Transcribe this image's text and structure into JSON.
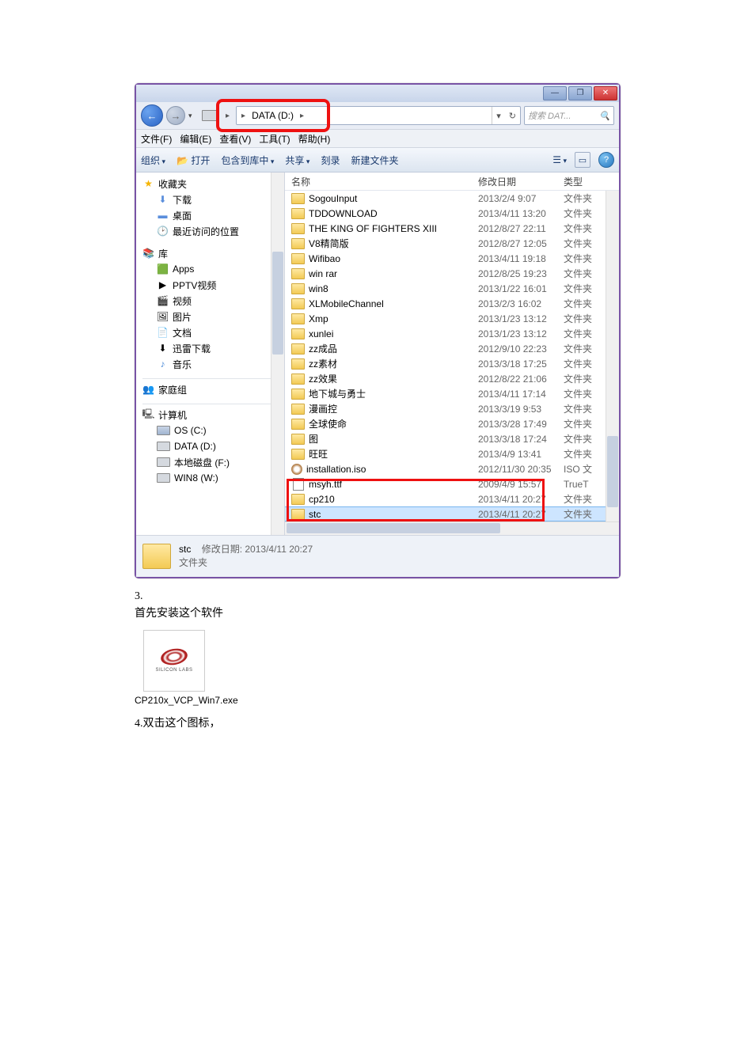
{
  "titlebar": {
    "min": "—",
    "max": "❐",
    "close": "✕"
  },
  "nav": {
    "back": "←",
    "fwd": "→",
    "addr_drive": "DATA (D:)",
    "search_placeholder": "搜索 DAT...",
    "refresh": "↻"
  },
  "menu": {
    "file": "文件(F)",
    "edit": "编辑(E)",
    "view": "查看(V)",
    "tools": "工具(T)",
    "help": "帮助(H)"
  },
  "toolbar": {
    "organize": "组织",
    "open": "打开",
    "include": "包含到库中",
    "share": "共享",
    "burn": "刻录",
    "newfolder": "新建文件夹",
    "view_icon": "☰"
  },
  "navpane": {
    "favorites": "收藏夹",
    "downloads": "下载",
    "desktop": "桌面",
    "recent": "最近访问的位置",
    "libraries": "库",
    "apps": "Apps",
    "pptv": "PPTV视频",
    "video": "视频",
    "pictures": "图片",
    "documents": "文档",
    "xunlei_dl": "迅雷下载",
    "music": "音乐",
    "homegroup": "家庭组",
    "computer": "计算机",
    "os_c": "OS (C:)",
    "data_d": "DATA (D:)",
    "local_f": "本地磁盘 (F:)",
    "win8_w": "WIN8 (W:)"
  },
  "columns": {
    "name": "名称",
    "date": "修改日期",
    "type": "类型"
  },
  "rows": [
    {
      "icon": "folder",
      "name": "SogouInput",
      "date": "2013/2/4 9:07",
      "type": "文件夹"
    },
    {
      "icon": "folder",
      "name": "TDDOWNLOAD",
      "date": "2013/4/11 13:20",
      "type": "文件夹"
    },
    {
      "icon": "folder",
      "name": "THE KING OF FIGHTERS XIII",
      "date": "2012/8/27 22:11",
      "type": "文件夹"
    },
    {
      "icon": "folder",
      "name": "V8精简版",
      "date": "2012/8/27 12:05",
      "type": "文件夹"
    },
    {
      "icon": "folder",
      "name": "Wifibao",
      "date": "2013/4/11 19:18",
      "type": "文件夹"
    },
    {
      "icon": "folder",
      "name": "win rar",
      "date": "2012/8/25 19:23",
      "type": "文件夹"
    },
    {
      "icon": "folder",
      "name": "win8",
      "date": "2013/1/22 16:01",
      "type": "文件夹"
    },
    {
      "icon": "folder",
      "name": "XLMobileChannel",
      "date": "2013/2/3 16:02",
      "type": "文件夹"
    },
    {
      "icon": "folder",
      "name": "Xmp",
      "date": "2013/1/23 13:12",
      "type": "文件夹"
    },
    {
      "icon": "folder",
      "name": "xunlei",
      "date": "2013/1/23 13:12",
      "type": "文件夹"
    },
    {
      "icon": "folder",
      "name": "zz成品",
      "date": "2012/9/10 22:23",
      "type": "文件夹"
    },
    {
      "icon": "folder",
      "name": "zz素材",
      "date": "2013/3/18 17:25",
      "type": "文件夹"
    },
    {
      "icon": "folder",
      "name": "zz效果",
      "date": "2012/8/22 21:06",
      "type": "文件夹"
    },
    {
      "icon": "folder",
      "name": "地下城与勇士",
      "date": "2013/4/11 17:14",
      "type": "文件夹"
    },
    {
      "icon": "folder",
      "name": "漫画控",
      "date": "2013/3/19 9:53",
      "type": "文件夹"
    },
    {
      "icon": "folder",
      "name": "全球使命",
      "date": "2013/3/28 17:49",
      "type": "文件夹"
    },
    {
      "icon": "folder",
      "name": "图",
      "date": "2013/3/18 17:24",
      "type": "文件夹"
    },
    {
      "icon": "folder",
      "name": "旺旺",
      "date": "2013/4/9 13:41",
      "type": "文件夹"
    },
    {
      "icon": "iso",
      "name": "installation.iso",
      "date": "2012/11/30 20:35",
      "type": "ISO 文"
    },
    {
      "icon": "file",
      "name": "msyh.ttf",
      "date": "2009/4/9 15:57",
      "type": "TrueT"
    },
    {
      "icon": "folder",
      "name": "cp210",
      "date": "2013/4/11 20:27",
      "type": "文件夹"
    },
    {
      "icon": "folder",
      "name": "stc",
      "date": "2013/4/11 20:27",
      "type": "文件夹",
      "selected": true
    }
  ],
  "status": {
    "name": "stc",
    "date_label": "修改日期:",
    "date": "2013/4/11 20:27",
    "type": "文件夹"
  },
  "doc": {
    "step3_num": "3.",
    "step3_text": "首先安装这个软件",
    "exe_name": "CP210x_VCP_Win7.exe",
    "silabs": "SILICON LABS",
    "step4": "4.双击这个图标，"
  }
}
